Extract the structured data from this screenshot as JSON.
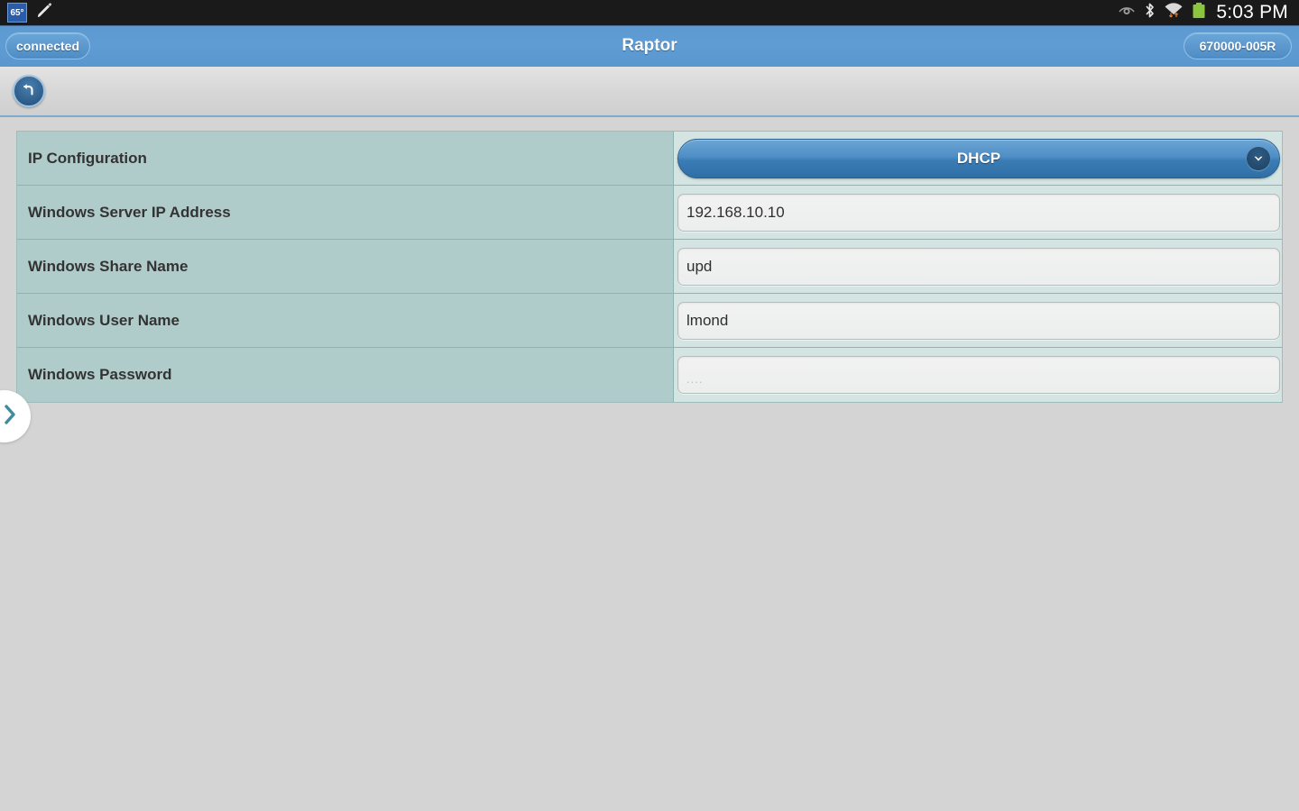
{
  "statusbar": {
    "temperature_badge": "65°",
    "pencil_icon": "pencil-icon",
    "eye_icon": "eye-icon",
    "bluetooth_icon": "bluetooth-icon",
    "wifi_icon": "wifi-icon",
    "battery_icon": "battery-icon",
    "time": "5:03 PM"
  },
  "titlebar": {
    "connection_status": "connected",
    "title": "Raptor",
    "serial": "670000-005R"
  },
  "toolbar": {
    "back_icon": "back-undo-icon"
  },
  "drawer": {
    "handle_icon": "chevron-right-icon"
  },
  "form": {
    "rows": [
      {
        "label": "IP Configuration",
        "control": "dropdown",
        "value": "DHCP",
        "chevron_icon": "chevron-down-icon"
      },
      {
        "label": "Windows Server IP Address",
        "control": "text",
        "value": "192.168.10.10",
        "placeholder": ""
      },
      {
        "label": "Windows Share Name",
        "control": "text",
        "value": "upd",
        "placeholder": ""
      },
      {
        "label": "Windows User Name",
        "control": "text",
        "value": "lmond",
        "placeholder": ""
      },
      {
        "label": "Windows Password",
        "control": "password",
        "value": "",
        "placeholder": "...."
      }
    ]
  },
  "colors": {
    "titlebar_blue": "#5d9ad2",
    "label_cell": "#b0ccca",
    "value_cell": "#d3e4e2",
    "page_background": "#d4d4d4",
    "dropdown_blue": "#3a7cb4",
    "battery_green": "#8bc53f",
    "status_black": "#1a1a1a"
  }
}
